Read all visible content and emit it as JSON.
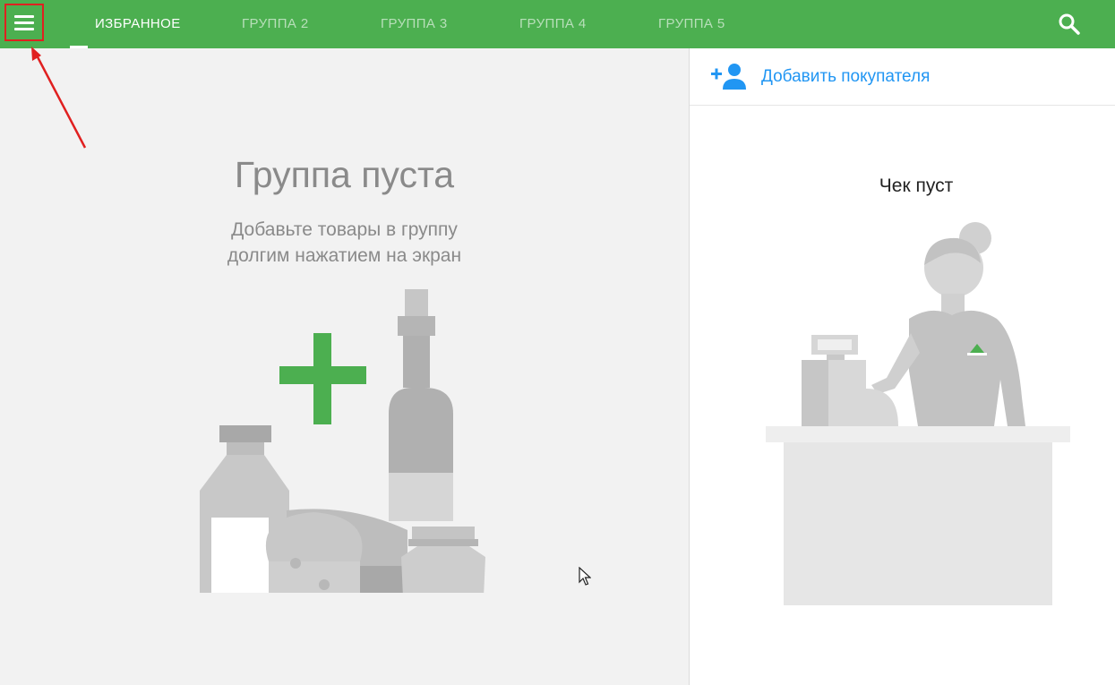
{
  "header": {
    "tabs": [
      {
        "label": "ИЗБРАННОЕ",
        "active": true
      },
      {
        "label": "ГРУППА 2",
        "active": false
      },
      {
        "label": "ГРУППА 3",
        "active": false
      },
      {
        "label": "ГРУППА 4",
        "active": false
      },
      {
        "label": "ГРУППА 5",
        "active": false
      }
    ],
    "menu_icon": "hamburger-menu-icon",
    "search_icon": "search-icon",
    "bar_color": "#4caf50"
  },
  "left_panel": {
    "title": "Группа пуста",
    "subtitle_line1": "Добавьте товары в группу",
    "subtitle_line2": "долгим нажатием на экран",
    "illustration": "groceries-illustration",
    "accent_color": "#4caf50"
  },
  "right_panel": {
    "add_customer_label": "Добавить покупателя",
    "add_customer_icon": "add-person-icon",
    "receipt_empty": "Чек пуст",
    "illustration": "cashier-illustration",
    "link_color": "#2196f3"
  }
}
